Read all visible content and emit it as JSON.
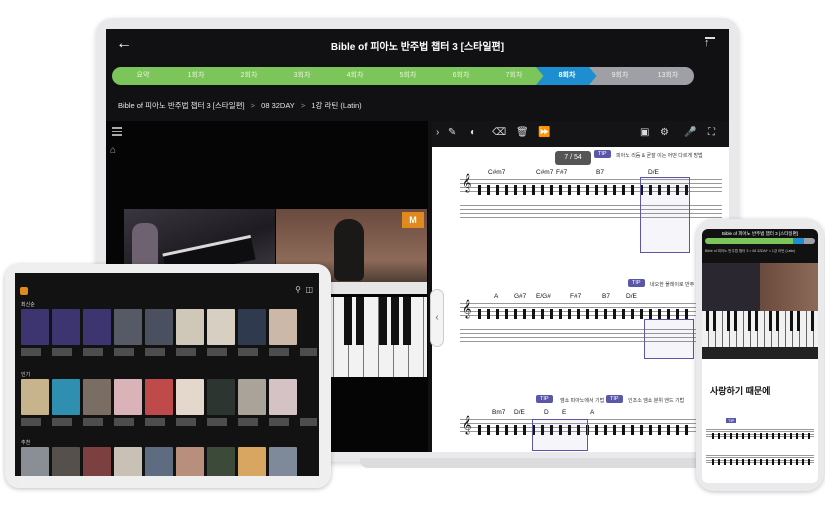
{
  "laptop": {
    "title": "Bible of 피아노 반주법 챕터 3 [스타일편]",
    "steps": [
      {
        "label": "요약",
        "state": "done"
      },
      {
        "label": "1회차",
        "state": "done"
      },
      {
        "label": "2회차",
        "state": "done"
      },
      {
        "label": "3회차",
        "state": "done"
      },
      {
        "label": "4회차",
        "state": "done"
      },
      {
        "label": "5회차",
        "state": "done"
      },
      {
        "label": "6회차",
        "state": "done"
      },
      {
        "label": "7회차",
        "state": "done"
      },
      {
        "label": "8회차",
        "state": "current"
      },
      {
        "label": "9회차",
        "state": "todo"
      },
      {
        "label": "13회차",
        "state": "todo"
      }
    ],
    "breadcrumb": [
      "Bible of 피아노 반주법 챕터 3 [스타일편]",
      "08 32DAY",
      "1강 라틴 (Latin)"
    ],
    "breadcrumb_sep": ">",
    "logo_text": "M",
    "page_indicator": "7 / 54",
    "score": {
      "tip_label": "TIP",
      "tip_1": "피아노 리듬 & 곧잘 이는 어떤 다르게 방법",
      "tip_2": "네오한 플레이로 반주 기법",
      "tip_3": "엠쇼 피아노에서 기법",
      "tip_4": "인조소 엠쇼 분위 엔드 기법",
      "row1_chords": [
        "C#m7",
        "C#m7",
        "F#7",
        "B7",
        "D/E"
      ],
      "row2_chords": [
        "A",
        "G#7",
        "E/G#",
        "F#7",
        "B7",
        "D/E"
      ],
      "row3_chords": [
        "Bm7",
        "D/E",
        "D",
        "E",
        "A"
      ]
    },
    "colors": {
      "done": "#7bc55a",
      "current": "#1d8ed0",
      "todo": "#9fa0a6",
      "tip": "#5a56a8"
    }
  },
  "tablet": {
    "section_1": "최신순",
    "section_2": "인기",
    "section_3": "추천"
  },
  "phone": {
    "title": "Bible of 피아노 반주법 챕터 3 [스타일편]",
    "breadcrumb": "Bible of 피아노 반주법 챕터 3 > 08 32DAY > 1강 라틴 (Latin)",
    "lyric": "사랑하기 때문에",
    "tip_label": "TIP"
  },
  "icons": [
    "back-arrow-icon",
    "export-icon",
    "list-icon",
    "home-icon",
    "pen-icon",
    "palette-icon",
    "eraser-icon",
    "trash-icon",
    "skip-icon",
    "save-icon",
    "mic-icon",
    "fullscreen-icon",
    "chevron-left-icon",
    "search-icon",
    "cart-icon"
  ]
}
